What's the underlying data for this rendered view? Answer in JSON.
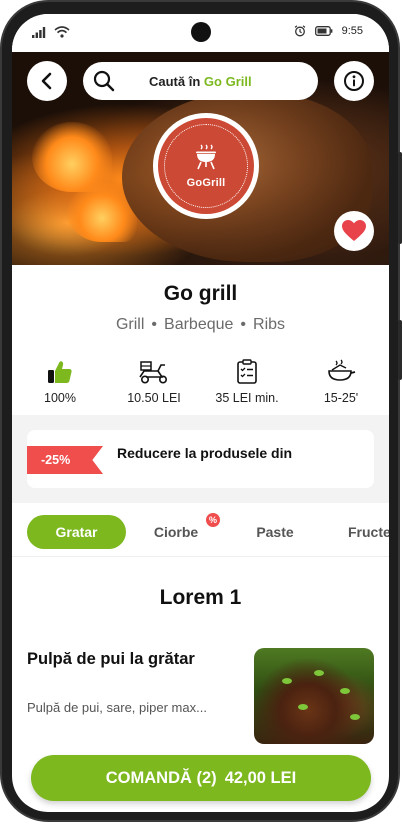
{
  "status_bar": {
    "time": "9:55"
  },
  "search": {
    "prefix": "Caută în",
    "brand": "Go Grill"
  },
  "logo": {
    "text": "GoGrill"
  },
  "restaurant": {
    "name": "Go grill",
    "tags": [
      "Grill",
      "Barbeque",
      "Ribs"
    ],
    "stats": [
      {
        "icon": "thumbs-up-icon",
        "value": "100%"
      },
      {
        "icon": "delivery-scooter-icon",
        "value": "10.50 LEI"
      },
      {
        "icon": "checklist-icon",
        "value": "35 LEI min."
      },
      {
        "icon": "cooking-pan-icon",
        "value": "15-25'"
      }
    ]
  },
  "promo": {
    "badge": "-25%",
    "text": "Reducere la produsele din"
  },
  "tabs": [
    {
      "label": "Gratar",
      "active": true
    },
    {
      "label": "Ciorbe",
      "badge": "%"
    },
    {
      "label": "Paste"
    },
    {
      "label": "Fructe"
    }
  ],
  "section": {
    "title": "Lorem 1"
  },
  "product": {
    "name": "Pulpă de pui la grătar",
    "description": "Pulpă de pui, sare, piper max..."
  },
  "order": {
    "label": "COMANDĂ (2)",
    "total": "42,00 LEI"
  },
  "colors": {
    "accent": "#7cb81e",
    "promo": "#f04d4d",
    "logo": "#cc4a35",
    "favorite": "#e8424a"
  }
}
